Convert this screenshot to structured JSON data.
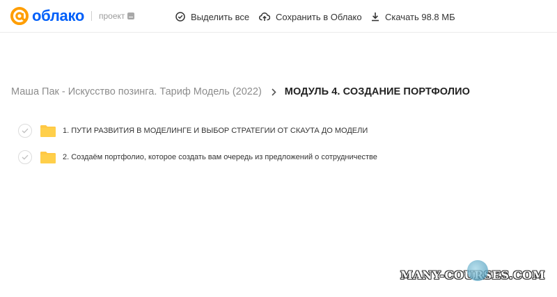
{
  "header": {
    "logo_text": "облако",
    "project_label": "проект",
    "actions": {
      "select_all": "Выделить все",
      "save_to_cloud": "Сохранить в Облако",
      "download": "Скачать 98.8 МБ"
    }
  },
  "breadcrumb": {
    "parent": "Маша Пак - Искусство позинга. Тариф Модель (2022)",
    "current": "МОДУЛЬ 4. СОЗДАНИЕ ПОРТФОЛИО"
  },
  "items": [
    {
      "label": "1. ПУТИ РАЗВИТИЯ В МОДЕЛИНГЕ И ВЫБОР СТРАТЕГИИ ОТ СКАУТА ДО МОДЕЛИ"
    },
    {
      "label": "2. Создаём портфолио, которое создать вам очередь из предложений о сотрудничестве"
    }
  ],
  "watermark": "MANY-COURSES.COM",
  "colors": {
    "brand": "#005ff9",
    "folder": "#ffc845",
    "accent_at": "#ff9e00"
  }
}
